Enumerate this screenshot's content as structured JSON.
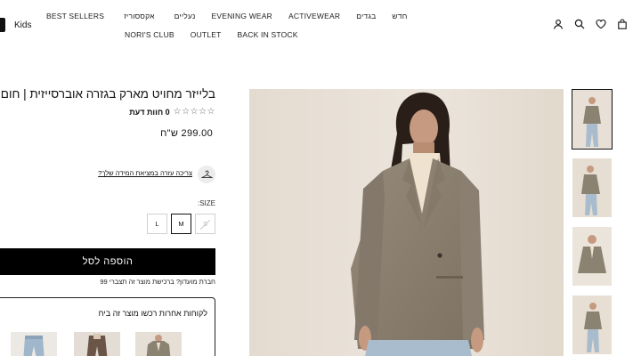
{
  "header": {
    "kids": "Kids",
    "nav_row1": [
      "BEST SELLERS",
      "אקססוריז",
      "נעליים",
      "EVENING WEAR",
      "ACTIVEWEAR",
      "בגדים",
      "חדש"
    ],
    "nav_row2": [
      "NORI'S CLUB",
      "OUTLET",
      "BACK IN STOCK"
    ],
    "icons": [
      "user-icon",
      "search-icon",
      "heart-icon",
      "bag-icon"
    ]
  },
  "product": {
    "title": "בלייזר מחויט מארק בגזרה אוברסייזית | חום אפר",
    "stars": "☆☆☆☆☆",
    "reviews": "0 חוות דעת",
    "price": "299.00 ש\"ח",
    "help_link": "צריכה עזרה במציאת המידה שלך?",
    "size_label": "SIZE:",
    "sizes": [
      {
        "label": "S",
        "available": false,
        "selected": false
      },
      {
        "label": "M",
        "available": true,
        "selected": true
      },
      {
        "label": "L",
        "available": true,
        "selected": false
      }
    ],
    "add_to_cart": "הוספה לסל",
    "member_note": "חברת מועדון? ברכישת מוצר זה תצברי 99",
    "also_bought_title": "לקוחות אחרות רכשו מוצר זה ביח"
  },
  "colors": {
    "background": "#ffffff",
    "button": "#000000",
    "photo_backdrop": "#e8e1d8",
    "blazer": "#8c8272"
  }
}
